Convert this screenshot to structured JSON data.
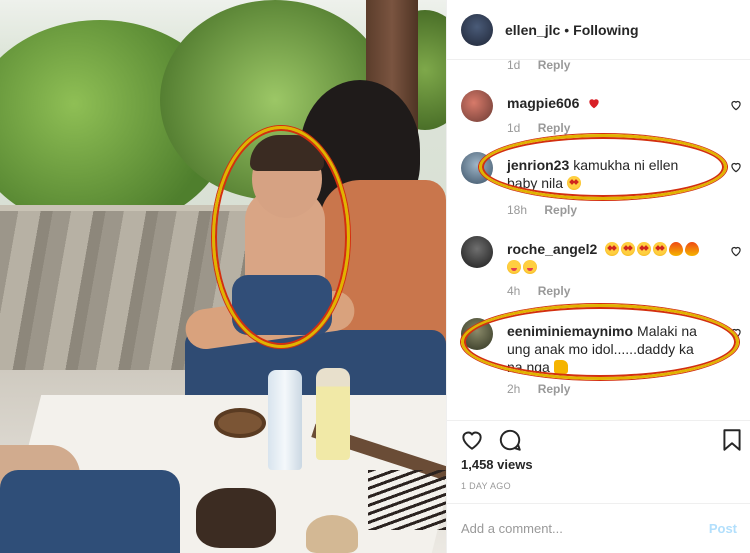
{
  "post_header": {
    "username": "ellen_jlc",
    "separator": "•",
    "follow_state": "Following"
  },
  "partial_comment": {
    "time": "1d",
    "reply_label": "Reply"
  },
  "comments": [
    {
      "username": "magpie606",
      "text": "",
      "emoji": [
        "red-heart"
      ],
      "time": "1d",
      "reply_label": "Reply"
    },
    {
      "username": "jenrion23",
      "text": "kamukha ni ellen baby nila",
      "emoji": [
        "star-struck"
      ],
      "time": "18h",
      "reply_label": "Reply"
    },
    {
      "username": "roche_angel2",
      "text": "",
      "emoji": [
        "star-struck",
        "star-struck",
        "star-struck",
        "star-struck",
        "fire",
        "fire",
        "yum",
        "yum"
      ],
      "time": "4h",
      "reply_label": "Reply"
    },
    {
      "username": "eeniminiemaynimo",
      "text": "Malaki na ung anak mo idol......daddy ka na nga",
      "emoji": [
        "thumbs-up"
      ],
      "time": "2h",
      "reply_label": "Reply"
    }
  ],
  "actions": {
    "views": "1,458 views",
    "date": "1 DAY AGO"
  },
  "add_comment": {
    "placeholder": "Add a comment...",
    "post_label": "Post"
  },
  "colors": {
    "highlight_ring": "#e1b300",
    "highlight_ring_edge": "#d32f0f",
    "post_button_disabled": "#b2dffc",
    "meta_text": "#999999"
  },
  "icons": [
    "heart-outline-icon",
    "comment-bubble-icon",
    "bookmark-icon",
    "red-heart-emoji",
    "star-struck-emoji",
    "fire-emoji",
    "yum-emoji",
    "thumbs-up-emoji"
  ]
}
